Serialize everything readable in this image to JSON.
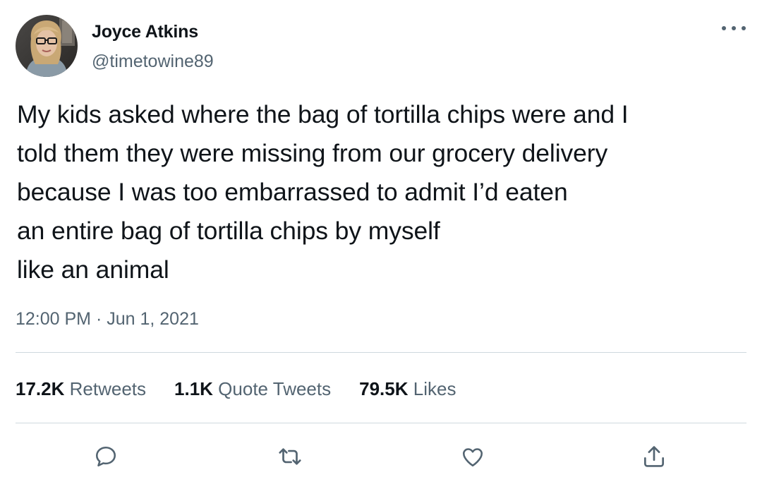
{
  "tweet": {
    "author": {
      "display_name": "Joyce Atkins",
      "handle": "@timetowine89"
    },
    "text_lines": [
      "My kids asked where the bag of tortilla chips were and I",
      "told them they were missing from our grocery delivery",
      "because I was too embarrassed to admit I’d eaten",
      "an entire bag of tortilla chips by myself",
      "like an animal"
    ],
    "timestamp": "12:00 PM · Jun 1, 2021",
    "stats": {
      "retweets": {
        "count": "17.2K",
        "label": "Retweets"
      },
      "quote_tweets": {
        "count": "1.1K",
        "label": "Quote Tweets"
      },
      "likes": {
        "count": "79.5K",
        "label": "Likes"
      }
    },
    "actions": [
      "reply-icon",
      "retweet-icon",
      "like-icon",
      "share-icon"
    ],
    "more_icon": "more-horizontal-icon"
  },
  "colors": {
    "text_primary": "#0f1419",
    "text_secondary": "#536471",
    "divider": "#cfd9de",
    "background": "#ffffff"
  }
}
